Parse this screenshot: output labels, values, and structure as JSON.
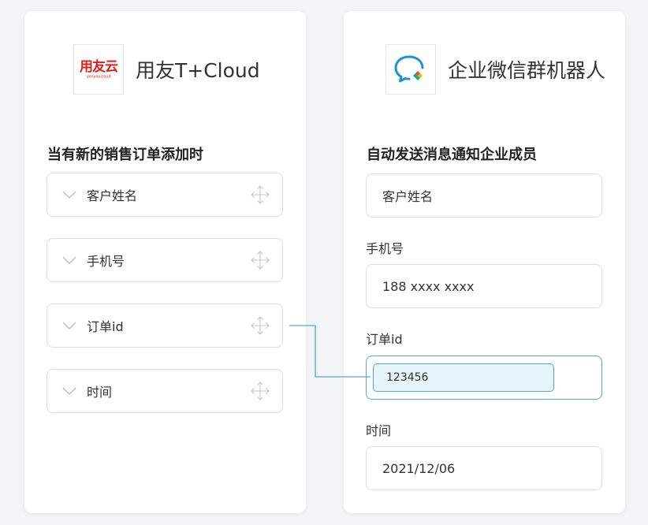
{
  "source_app": {
    "name": "用友T+Cloud",
    "logo_mark": "用友云",
    "logo_sub": "yonyoucloud",
    "trigger_title": "当有新的销售订单添加时",
    "fields": [
      {
        "label": "客户姓名"
      },
      {
        "label": "手机号"
      },
      {
        "label": "订单id"
      },
      {
        "label": "时间"
      }
    ]
  },
  "target_app": {
    "name": "企业微信群机器人",
    "action_title": "自动发送消息通知企业成员",
    "fields": [
      {
        "label": "",
        "value": "客户姓名"
      },
      {
        "label": "手机号",
        "value": "188 xxxx xxxx"
      },
      {
        "label": "订单id",
        "value": "123456"
      },
      {
        "label": "时间",
        "value": "2021/12/06"
      }
    ]
  },
  "colors": {
    "accent_blue": "#52a9d8",
    "chip_bg": "#e6f4fc",
    "brand_red": "#d9201c"
  },
  "icons": {
    "chevron": "chevron-down-icon",
    "move": "move-icon",
    "source_logo": "yonyou-cloud-logo",
    "target_logo": "wecom-robot-logo"
  }
}
